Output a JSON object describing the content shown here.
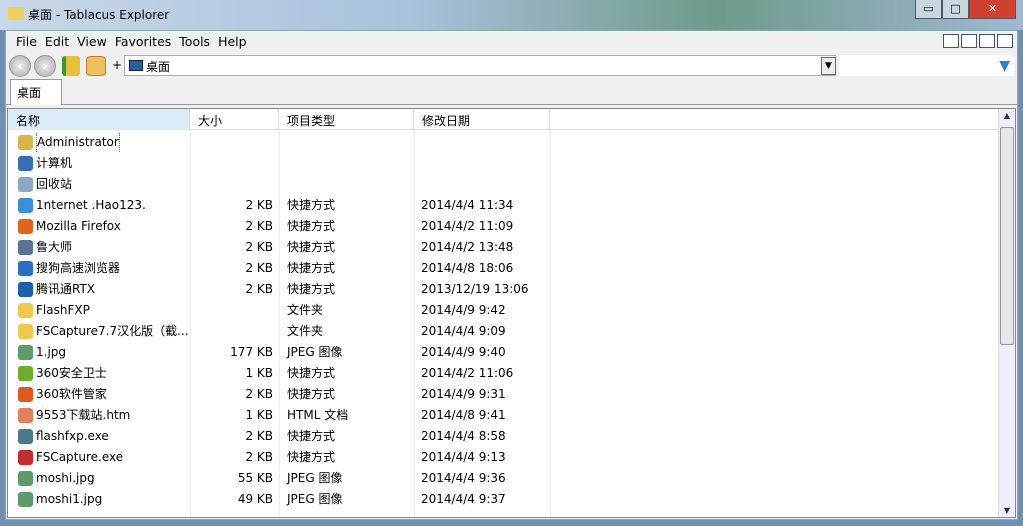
{
  "window": {
    "title": "桌面 - Tablacus Explorer",
    "minimize": "▭",
    "maximize": "□",
    "close": "✕"
  },
  "menu": [
    "File",
    "Edit",
    "View",
    "Favorites",
    "Tools",
    "Help"
  ],
  "nav": {
    "back": "‹",
    "forward": "›",
    "plus": "+",
    "address": "桌面",
    "dropdown": "▼",
    "filter": "▼"
  },
  "tabs": [
    "桌面"
  ],
  "columns": [
    "名称",
    "大小",
    "项目类型",
    "修改日期"
  ],
  "rows": [
    {
      "name": "Administrator",
      "size": "",
      "type": "",
      "date": "",
      "color": "#d9b44a"
    },
    {
      "name": "计算机",
      "size": "",
      "type": "",
      "date": "",
      "color": "#3a6fb8"
    },
    {
      "name": "回收站",
      "size": "",
      "type": "",
      "date": "",
      "color": "#8ca6c4"
    },
    {
      "name": "1nternet .Hao123.",
      "size": "2 KB",
      "type": "快捷方式",
      "date": "2014/4/4 11:34",
      "color": "#3b8fd9"
    },
    {
      "name": "Mozilla Firefox",
      "size": "2 KB",
      "type": "快捷方式",
      "date": "2014/4/2 11:09",
      "color": "#e0661f"
    },
    {
      "name": "鲁大师",
      "size": "2 KB",
      "type": "快捷方式",
      "date": "2014/4/2 13:48",
      "color": "#5a7390"
    },
    {
      "name": "搜狗高速浏览器",
      "size": "2 KB",
      "type": "快捷方式",
      "date": "2014/4/8 18:06",
      "color": "#2a6ec0"
    },
    {
      "name": "腾讯通RTX",
      "size": "2 KB",
      "type": "快捷方式",
      "date": "2013/12/19 13:06",
      "color": "#1f5fa8"
    },
    {
      "name": "FlashFXP",
      "size": "",
      "type": "文件夹",
      "date": "2014/4/9 9:42",
      "color": "#f0c850"
    },
    {
      "name": "FSCapture7.7汉化版（截...",
      "size": "",
      "type": "文件夹",
      "date": "2014/4/4 9:09",
      "color": "#f0c850"
    },
    {
      "name": "1.jpg",
      "size": "177 KB",
      "type": "JPEG 图像",
      "date": "2014/4/9 9:40",
      "color": "#5d9b6a"
    },
    {
      "name": "360安全卫士",
      "size": "1 KB",
      "type": "快捷方式",
      "date": "2014/4/2 11:06",
      "color": "#6fae2a"
    },
    {
      "name": "360软件管家",
      "size": "2 KB",
      "type": "快捷方式",
      "date": "2014/4/9 9:31",
      "color": "#e05a20"
    },
    {
      "name": "9553下载站.htm",
      "size": "1 KB",
      "type": "HTML 文档",
      "date": "2014/4/8 9:41",
      "color": "#e08060"
    },
    {
      "name": "flashfxp.exe",
      "size": "2 KB",
      "type": "快捷方式",
      "date": "2014/4/4 8:58",
      "color": "#4a7a8a"
    },
    {
      "name": "FSCapture.exe",
      "size": "2 KB",
      "type": "快捷方式",
      "date": "2014/4/4 9:13",
      "color": "#c03030"
    },
    {
      "name": "moshi.jpg",
      "size": "55 KB",
      "type": "JPEG 图像",
      "date": "2014/4/4 9:36",
      "color": "#5d9b6a"
    },
    {
      "name": "moshi1.jpg",
      "size": "49 KB",
      "type": "JPEG 图像",
      "date": "2014/4/4 9:37",
      "color": "#5d9b6a"
    }
  ]
}
